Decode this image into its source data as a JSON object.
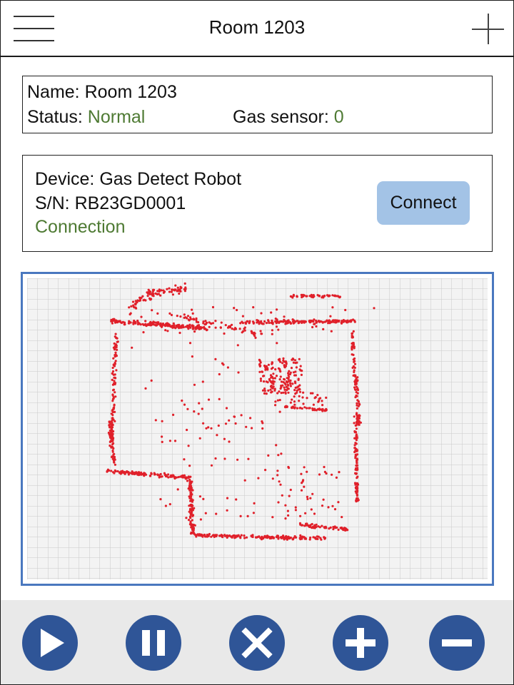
{
  "header": {
    "title": "Room 1203",
    "menu_icon": "hamburger-menu-icon",
    "add_icon": "plus-icon"
  },
  "room": {
    "name_label": "Name:",
    "name_value": "Room 1203",
    "status_label": "Status:",
    "status_value": "Normal",
    "gas_label": "Gas sensor:",
    "gas_value": "0"
  },
  "device": {
    "device_label": "Device:",
    "device_value": "Gas Detect Robot",
    "sn_label": "S/N:",
    "sn_value": "RB23GD0001",
    "connection_text": "Connection",
    "connect_button": "Connect"
  },
  "toolbar": {
    "buttons": [
      {
        "name": "play",
        "icon": "play-icon"
      },
      {
        "name": "pause",
        "icon": "pause-icon"
      },
      {
        "name": "stop",
        "icon": "close-icon"
      },
      {
        "name": "zoom-in",
        "icon": "plus-icon"
      },
      {
        "name": "zoom-out",
        "icon": "minus-icon"
      }
    ]
  },
  "colors": {
    "status_green": "#4e7a33",
    "connect_button": "#a3c3e6",
    "map_border": "#4a78bf",
    "map_points": "#e0202a",
    "toolbar_button": "#2f5597",
    "toolbar_bg": "#e9e9e9"
  }
}
